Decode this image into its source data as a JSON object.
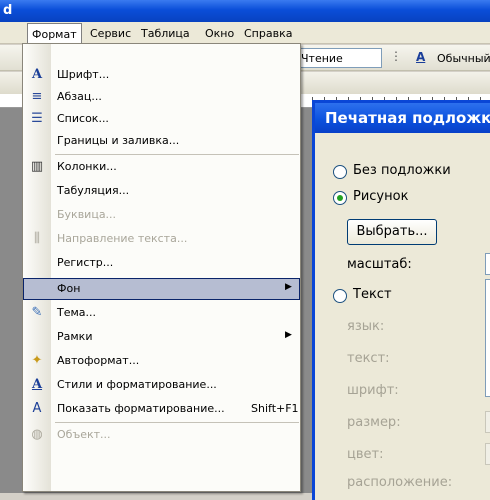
{
  "window": {
    "title": "d"
  },
  "menubar": {
    "items": [
      {
        "label": "Формат",
        "active": true
      },
      {
        "label": "Сервис"
      },
      {
        "label": "Таблица"
      },
      {
        "label": "Окно"
      },
      {
        "label": "Справка"
      }
    ]
  },
  "toolbar": {
    "view_combo": "Чтение",
    "style_combo": "Обычный"
  },
  "format_menu": {
    "items": [
      {
        "label": "Шрифт...",
        "icon": "font-a-icon"
      },
      {
        "label": "Абзац...",
        "icon": "paragraph-icon"
      },
      {
        "label": "Список...",
        "icon": "list-icon"
      },
      {
        "label": "Границы и заливка...",
        "icon": ""
      },
      {
        "label": "Колонки...",
        "icon": "columns-icon"
      },
      {
        "label": "Табуляция...",
        "icon": ""
      },
      {
        "label": "Буквица...",
        "icon": "",
        "disabled": true
      },
      {
        "label": "Направление текста...",
        "icon": "text-direction-icon",
        "disabled": true
      },
      {
        "label": "Регистр...",
        "icon": ""
      },
      {
        "label": "Фон",
        "icon": "",
        "submenu": true,
        "highlighted": true
      },
      {
        "label": "Тема...",
        "icon": "theme-icon"
      },
      {
        "label": "Рамки",
        "icon": "",
        "submenu": true
      },
      {
        "label": "Автоформат...",
        "icon": "autoformat-icon"
      },
      {
        "label": "Стили и форматирование...",
        "icon": "styles-icon"
      },
      {
        "label": "Показать форматирование...",
        "icon": "reveal-format-icon",
        "shortcut": "Shift+F1"
      },
      {
        "label": "Объект...",
        "icon": "object-icon",
        "disabled": true
      }
    ]
  },
  "dialog": {
    "title": "Печатная подложка",
    "no_watermark": "Без подложки",
    "picture": "Рисунок",
    "choose_button": "Выбрать...",
    "scale_label": "масштаб:",
    "text_option": "Текст",
    "language_label": "язык:",
    "text_label": "текст:",
    "font_label": "шрифт:",
    "size_label": "размер:",
    "color_label": "цвет:",
    "layout_label": "расположение:"
  }
}
